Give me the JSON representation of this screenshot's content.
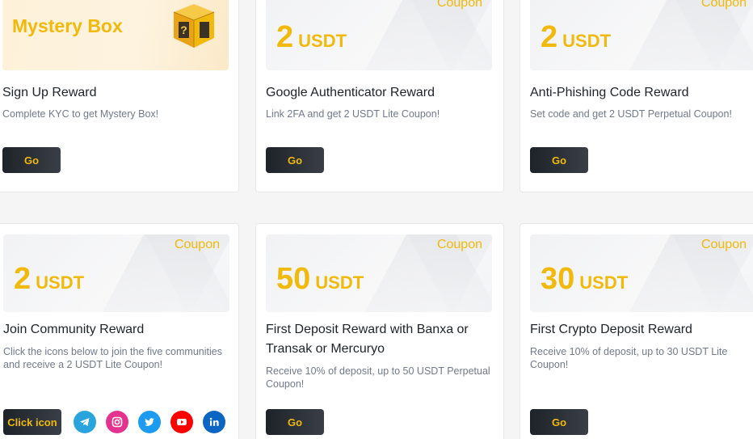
{
  "colors": {
    "accent": "#f0b90b",
    "button_bg": "#1e2329",
    "muted_text": "#707a8a"
  },
  "cards": [
    {
      "banner_title": "Mystery Box",
      "title": "Sign Up Reward",
      "description": "Complete KYC to get Mystery Box!",
      "button": "Go"
    },
    {
      "coupon_label": "Coupon",
      "amount": "2",
      "unit": "USDT",
      "title": "Google Authenticator Reward",
      "description": "Link 2FA and get 2 USDT Lite Coupon!",
      "button": "Go"
    },
    {
      "coupon_label": "Coupon",
      "amount": "2",
      "unit": "USDT",
      "title": "Anti-Phishing Code Reward",
      "description": "Set code and get 2 USDT Perpetual Coupon!",
      "button": "Go"
    },
    {
      "coupon_label": "Coupon",
      "amount": "2",
      "unit": "USDT",
      "title": "Join Community Reward",
      "description": "Click the icons below to join the five communities and receive a 2 USDT Lite Coupon!",
      "button": "Click icon",
      "social_icons": [
        "telegram-icon",
        "instagram-icon",
        "twitter-icon",
        "youtube-icon",
        "linkedin-icon"
      ]
    },
    {
      "coupon_label": "Coupon",
      "amount": "50",
      "unit": "USDT",
      "title": "First Deposit Reward with Banxa or Transak or Mercuryo",
      "description": "Receive 10% of deposit, up to 50 USDT Perpetual Coupon!",
      "button": "Go"
    },
    {
      "coupon_label": "Coupon",
      "amount": "30",
      "unit": "USDT",
      "title": "First Crypto Deposit Reward",
      "description": "Receive 10% of deposit, up to 30 USDT Lite Coupon!",
      "button": "Go"
    }
  ]
}
